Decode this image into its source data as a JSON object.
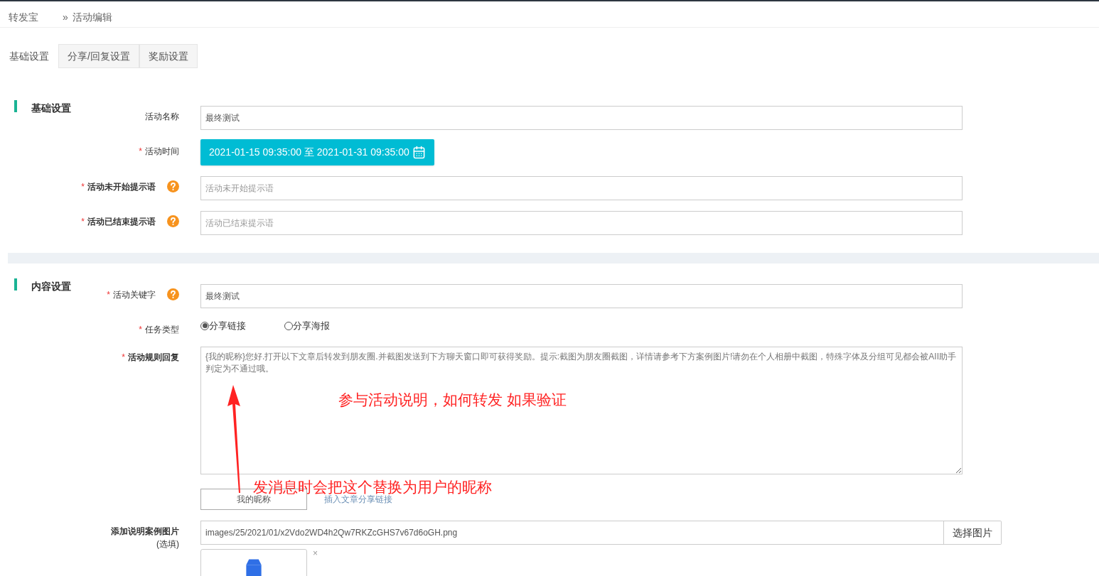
{
  "breadcrumb": {
    "root": "转发宝",
    "separator": "»",
    "current": "活动编辑"
  },
  "tabs": [
    {
      "label": "基础设置",
      "selected": true
    },
    {
      "label": "分享/回复设置",
      "selected": false
    },
    {
      "label": "奖励设置",
      "selected": false
    }
  ],
  "sections": [
    {
      "title": "基础设置",
      "fields": [
        {
          "kind": "text",
          "label": "活动名称",
          "bold": false,
          "value": "最终测试"
        },
        {
          "kind": "daterange",
          "label": "活动时间",
          "required_mark": "*",
          "bold": false,
          "value": "2021-01-15 09:35:00 至 2021-01-31 09:35:00"
        },
        {
          "kind": "text",
          "label": "活动未开始提示语",
          "required_mark": "*",
          "bold": true,
          "help": true,
          "placeholder": "活动未开始提示语"
        },
        {
          "kind": "text",
          "label": "活动已结束提示语",
          "required_mark": "*",
          "bold": true,
          "help": true,
          "placeholder": "活动已结束提示语"
        }
      ]
    },
    {
      "title": "内容设置",
      "fields": [
        {
          "kind": "text",
          "label": "活动关键字",
          "required_mark": "*",
          "bold": false,
          "help": true,
          "value": "最终测试"
        },
        {
          "kind": "radio",
          "label": "任务类型",
          "required_mark": "*",
          "bold": false,
          "options": [
            {
              "label": "分享链接",
              "selected": true
            },
            {
              "label": "分享海报",
              "selected": false
            }
          ]
        },
        {
          "kind": "textarea",
          "label": "活动规则回复",
          "required_mark": "*",
          "bold": true,
          "value": "{我的昵称}您好.打开以下文章后转发到朋友圈.并截图发送到下方聊天窗口即可获得奖励。提示:截图为朋友圈截图，详情请参考下方案例图片!请勿在个人相册中截图，特殊字体及分组可见都会被AII助手判定为不通过哦。",
          "insert_button": "我的昵称",
          "insert_link": "插入文章分享链接"
        },
        {
          "kind": "file",
          "label": "添加说明案例图片",
          "sublabel": "(选填)",
          "bold": true,
          "value": "images/25/2021/01/x2Vdo2WD4h2Qw7RKZcGHS7v67d6oGH.png",
          "button": "选择图片",
          "remove": "×"
        }
      ]
    }
  ],
  "annotations": [
    {
      "text": "参与活动说明，如何转发 如果验证"
    },
    {
      "text": "发消息时会把这个替换为用户的昵称"
    }
  ]
}
